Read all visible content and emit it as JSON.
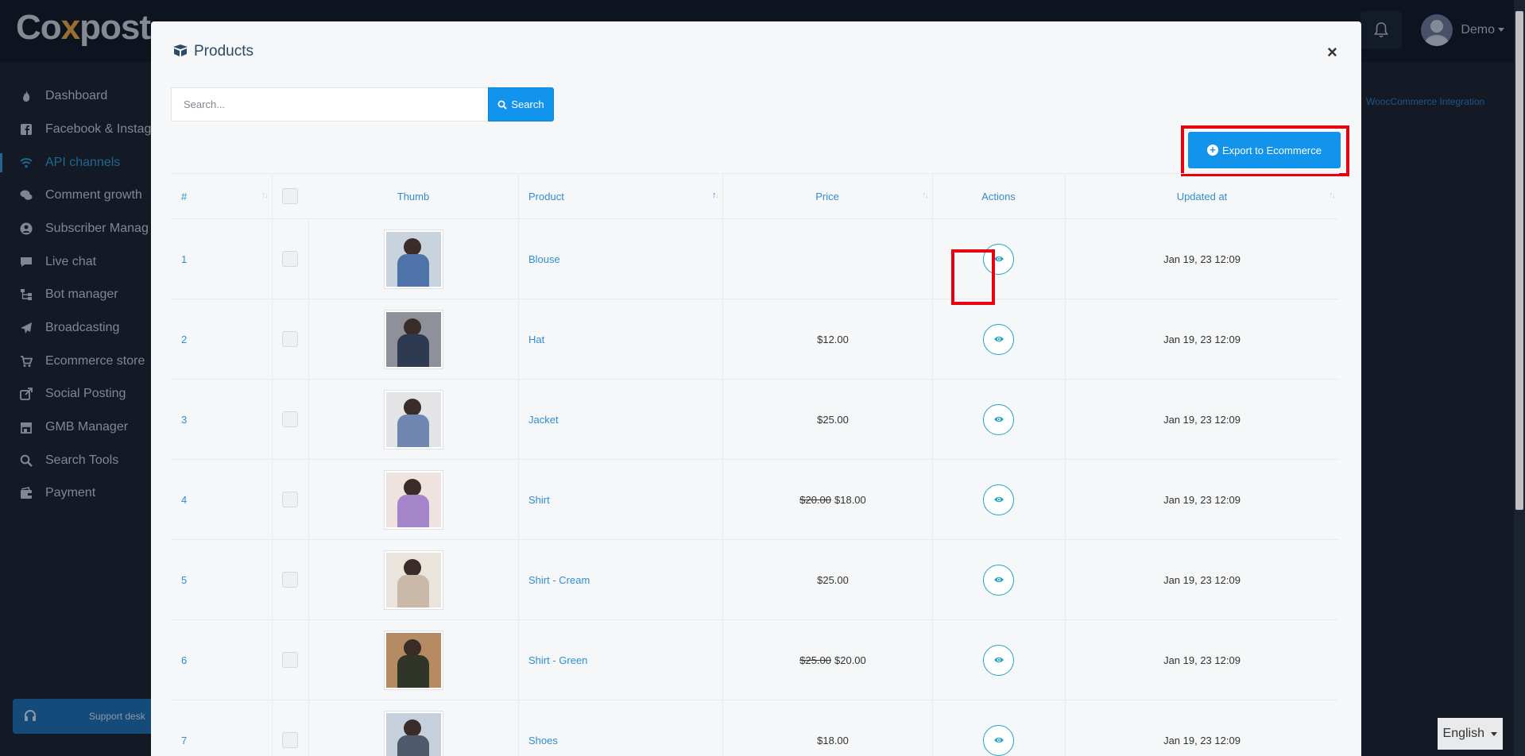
{
  "app": {
    "logo_text": "Co",
    "logo_x": "x",
    "logo_rest": "post",
    "user_name": "Demo",
    "bg_link": "WoocCommerce Integration",
    "language": "English"
  },
  "sidebar": {
    "items": [
      {
        "label": "Dashboard",
        "icon": "fire-icon"
      },
      {
        "label": "Facebook & Instag",
        "icon": "facebook-icon"
      },
      {
        "label": "API channels",
        "icon": "wifi-icon",
        "active": true
      },
      {
        "label": "Comment growth",
        "icon": "comments-icon"
      },
      {
        "label": "Subscriber Manag",
        "icon": "user-circle-icon"
      },
      {
        "label": "Live chat",
        "icon": "chat-icon"
      },
      {
        "label": "Bot manager",
        "icon": "sitemap-icon"
      },
      {
        "label": "Broadcasting",
        "icon": "paper-plane-icon"
      },
      {
        "label": "Ecommerce store",
        "icon": "cart-icon"
      },
      {
        "label": "Social Posting",
        "icon": "share-icon"
      },
      {
        "label": "GMB Manager",
        "icon": "store-icon"
      },
      {
        "label": "Search Tools",
        "icon": "search-icon"
      },
      {
        "label": "Payment",
        "icon": "wallet-icon"
      }
    ],
    "support_label": "Support desk"
  },
  "modal": {
    "title": "Products",
    "close": "×",
    "search_placeholder": "Search...",
    "search_button": "Search",
    "export_button": "Export to Ecommerce"
  },
  "table": {
    "columns": [
      "#",
      "Thumb",
      "Product",
      "Price",
      "Actions",
      "Updated at"
    ],
    "rows": [
      {
        "num": "1",
        "product": "Blouse",
        "old_price": "",
        "price": "",
        "updated": "Jan 19, 23 12:09",
        "thumb_colors": [
          "#c9d3dd",
          "#4f73a8"
        ]
      },
      {
        "num": "2",
        "product": "Hat",
        "old_price": "",
        "price": "$12.00",
        "updated": "Jan 19, 23 12:09",
        "thumb_colors": [
          "#8e9199",
          "#2e3a52"
        ]
      },
      {
        "num": "3",
        "product": "Jacket",
        "old_price": "",
        "price": "$25.00",
        "updated": "Jan 19, 23 12:09",
        "thumb_colors": [
          "#e3e4e6",
          "#6f87b0"
        ]
      },
      {
        "num": "4",
        "product": "Shirt",
        "old_price": "$20.00",
        "price": "$18.00",
        "updated": "Jan 19, 23 12:09",
        "thumb_colors": [
          "#efe3df",
          "#a585c9"
        ]
      },
      {
        "num": "5",
        "product": "Shirt - Cream",
        "old_price": "",
        "price": "$25.00",
        "updated": "Jan 19, 23 12:09",
        "thumb_colors": [
          "#e9e4dc",
          "#c9b9a6"
        ]
      },
      {
        "num": "6",
        "product": "Shirt - Green",
        "old_price": "$25.00",
        "price": "$20.00",
        "updated": "Jan 19, 23 12:09",
        "thumb_colors": [
          "#b58b64",
          "#2f3528"
        ]
      },
      {
        "num": "7",
        "product": "Shoes",
        "old_price": "",
        "price": "$18.00",
        "updated": "Jan 19, 23 12:09",
        "thumb_colors": [
          "#c5d0dc",
          "#4d5a6b"
        ]
      }
    ]
  },
  "colors": {
    "accent": "#1394ec",
    "highlight": "#e8000f",
    "link": "#2f8fcf"
  }
}
